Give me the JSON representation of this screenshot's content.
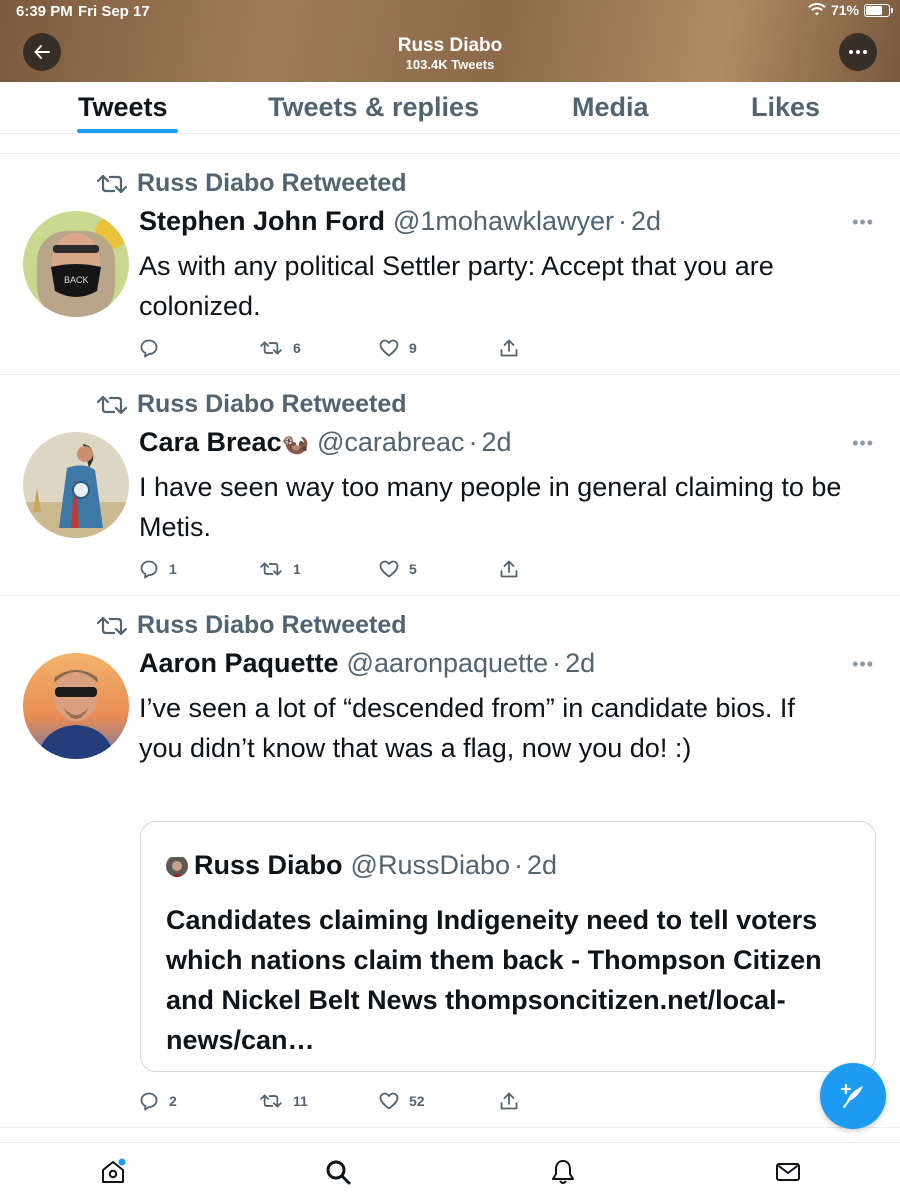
{
  "status_bar": {
    "time": "6:39 PM",
    "date": "Fri Sep 17",
    "battery": "71%",
    "battery_level": 0.71
  },
  "header": {
    "title": "Russ Diabo",
    "subtitle": "103.4K Tweets"
  },
  "tabs": [
    {
      "label": "Tweets",
      "active": true
    },
    {
      "label": "Tweets & replies",
      "active": false
    },
    {
      "label": "Media",
      "active": false
    },
    {
      "label": "Likes",
      "active": false
    }
  ],
  "tweets": [
    {
      "retweet_label": "Russ Diabo Retweeted",
      "name": "Stephen John Ford",
      "handle": "@1mohawklawyer",
      "time": "2d",
      "text": "As with any political Settler party: Accept that you are colonized.",
      "replies": "",
      "retweets": "6",
      "likes": "9"
    },
    {
      "retweet_label": "Russ Diabo Retweeted",
      "name": "Cara Breac",
      "name_emoji": "🦦",
      "handle": "@carabreac",
      "time": "2d",
      "text": "I have seen way too many people in general claiming to be Metis.",
      "replies": "1",
      "retweets": "1",
      "likes": "5"
    },
    {
      "retweet_label": "Russ Diabo Retweeted",
      "name": "Aaron Paquette",
      "handle": "@aaronpaquette",
      "time": "2d",
      "text": "I’ve seen a lot of “descended from” in candidate bios. If you didn’t know that was a flag, now you do! :)",
      "replies": "2",
      "retweets": "11",
      "likes": "52",
      "quote": {
        "name": "Russ Diabo",
        "handle": "@RussDiabo",
        "time": "2d",
        "text": "Candidates claiming Indigeneity need to tell voters which nations claim them back - Thompson Citizen and Nickel Belt News thompsoncitizen.net/local-news/can…"
      }
    }
  ],
  "colors": {
    "accent": "#1d9bf0",
    "secondary_text": "#536471",
    "primary_text": "#0f1419"
  },
  "icons": [
    "back-arrow-icon",
    "more-icon",
    "retweet-icon",
    "reply-icon",
    "like-icon",
    "share-icon",
    "compose-icon",
    "home-icon",
    "search-icon",
    "notifications-icon",
    "messages-icon"
  ]
}
